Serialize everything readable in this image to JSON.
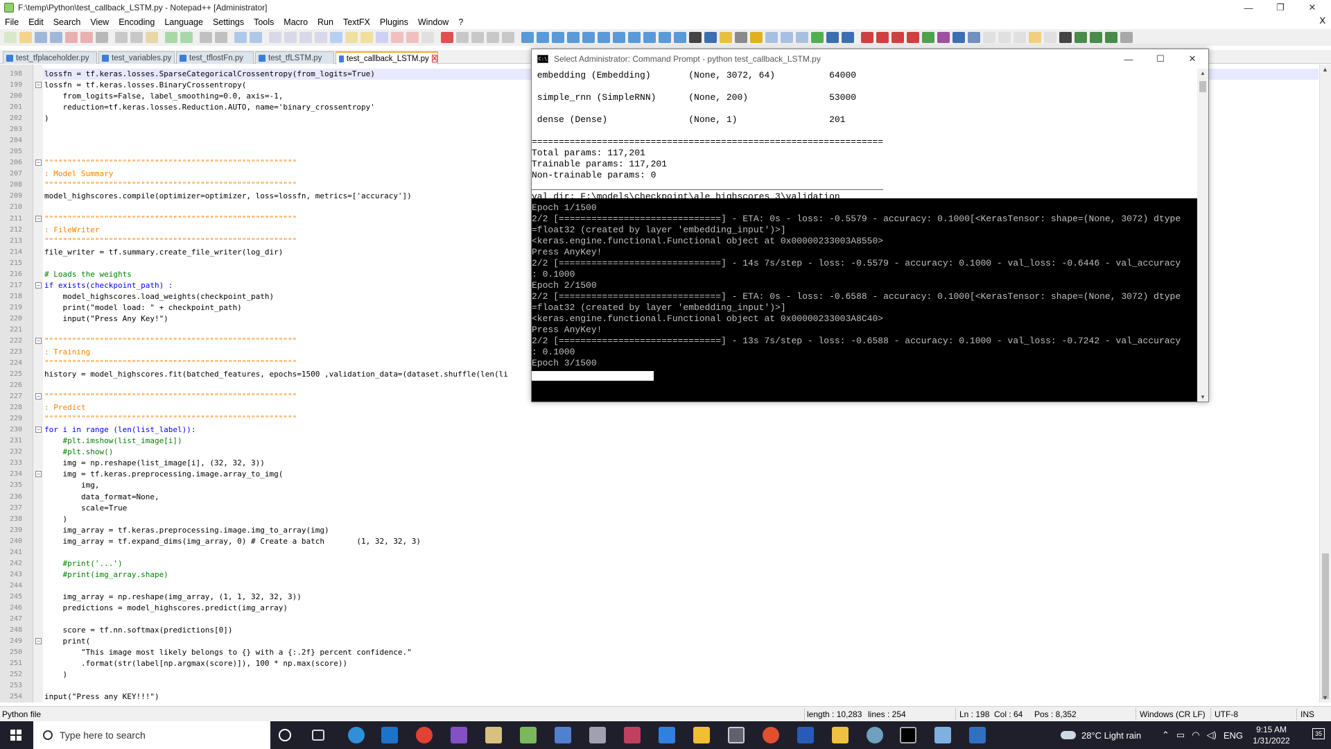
{
  "window": {
    "title": "F:\\temp\\Python\\test_callback_LSTM.py - Notepad++ [Administrator]",
    "minimize": "—",
    "maximize": "❐",
    "close": "✕"
  },
  "menu": {
    "items": [
      "File",
      "Edit",
      "Search",
      "View",
      "Encoding",
      "Language",
      "Settings",
      "Tools",
      "Macro",
      "Run",
      "TextFX",
      "Plugins",
      "Window",
      "?"
    ],
    "close_doc": "X"
  },
  "tabs": [
    {
      "label": "test_tfplaceholder.py"
    },
    {
      "label": "test_variables.py"
    },
    {
      "label": "test_tflostFn.py"
    },
    {
      "label": "test_tfLSTM.py"
    },
    {
      "label": "test_callback_LSTM.py",
      "close": "x"
    }
  ],
  "editor": {
    "lines": [
      {
        "n": "198",
        "t": "lossfn = tf.keras.losses.SparseCategoricalCrossentropy(from_logits=True)"
      },
      {
        "n": "199",
        "t": "lossfn = tf.keras.losses.BinaryCrossentropy("
      },
      {
        "n": "200",
        "t": "    from_logits=False, label_smoothing=0.0, axis=-1,"
      },
      {
        "n": "201",
        "t": "    reduction=tf.keras.losses.Reduction.AUTO, name='binary_crossentropy'"
      },
      {
        "n": "202",
        "t": ")"
      },
      {
        "n": "203",
        "t": ""
      },
      {
        "n": "204",
        "t": ""
      },
      {
        "n": "205",
        "t": ""
      },
      {
        "n": "206",
        "t": "\"\"\"\"\"\"\"\"\"\"\"\"\"\"\"\"\"\"\"\"\"\"\"\"\"\"\"\"\"\"\"\"\"\"\"\"\"\"\"\"\"\"\"\"\"\"\"\"\"\"\"\"\"\"\""
      },
      {
        "n": "207",
        "t": ": Model Summary"
      },
      {
        "n": "208",
        "t": "\"\"\"\"\"\"\"\"\"\"\"\"\"\"\"\"\"\"\"\"\"\"\"\"\"\"\"\"\"\"\"\"\"\"\"\"\"\"\"\"\"\"\"\"\"\"\"\"\"\"\"\"\"\"\""
      },
      {
        "n": "209",
        "t": "model_highscores.compile(optimizer=optimizer, loss=lossfn, metrics=['accuracy'])"
      },
      {
        "n": "210",
        "t": ""
      },
      {
        "n": "211",
        "t": "\"\"\"\"\"\"\"\"\"\"\"\"\"\"\"\"\"\"\"\"\"\"\"\"\"\"\"\"\"\"\"\"\"\"\"\"\"\"\"\"\"\"\"\"\"\"\"\"\"\"\"\"\"\"\""
      },
      {
        "n": "212",
        "t": ": FileWriter"
      },
      {
        "n": "213",
        "t": "\"\"\"\"\"\"\"\"\"\"\"\"\"\"\"\"\"\"\"\"\"\"\"\"\"\"\"\"\"\"\"\"\"\"\"\"\"\"\"\"\"\"\"\"\"\"\"\"\"\"\"\"\"\"\""
      },
      {
        "n": "214",
        "t": "file_writer = tf.summary.create_file_writer(log_dir)"
      },
      {
        "n": "215",
        "t": ""
      },
      {
        "n": "216",
        "t": "# Loads the weights"
      },
      {
        "n": "217",
        "t": "if exists(checkpoint_path) :"
      },
      {
        "n": "218",
        "t": "    model_highscores.load_weights(checkpoint_path)"
      },
      {
        "n": "219",
        "t": "    print(\"model load: \" + checkpoint_path)"
      },
      {
        "n": "220",
        "t": "    input(\"Press Any Key!\")"
      },
      {
        "n": "221",
        "t": ""
      },
      {
        "n": "222",
        "t": "\"\"\"\"\"\"\"\"\"\"\"\"\"\"\"\"\"\"\"\"\"\"\"\"\"\"\"\"\"\"\"\"\"\"\"\"\"\"\"\"\"\"\"\"\"\"\"\"\"\"\"\"\"\"\""
      },
      {
        "n": "223",
        "t": ": Training"
      },
      {
        "n": "224",
        "t": "\"\"\"\"\"\"\"\"\"\"\"\"\"\"\"\"\"\"\"\"\"\"\"\"\"\"\"\"\"\"\"\"\"\"\"\"\"\"\"\"\"\"\"\"\"\"\"\"\"\"\"\"\"\"\""
      },
      {
        "n": "225",
        "t": "history = model_highscores.fit(batched_features, epochs=1500 ,validation_data=(dataset.shuffle(len(li"
      },
      {
        "n": "226",
        "t": ""
      },
      {
        "n": "227",
        "t": "\"\"\"\"\"\"\"\"\"\"\"\"\"\"\"\"\"\"\"\"\"\"\"\"\"\"\"\"\"\"\"\"\"\"\"\"\"\"\"\"\"\"\"\"\"\"\"\"\"\"\"\"\"\"\""
      },
      {
        "n": "228",
        "t": ": Predict"
      },
      {
        "n": "229",
        "t": "\"\"\"\"\"\"\"\"\"\"\"\"\"\"\"\"\"\"\"\"\"\"\"\"\"\"\"\"\"\"\"\"\"\"\"\"\"\"\"\"\"\"\"\"\"\"\"\"\"\"\"\"\"\"\""
      },
      {
        "n": "230",
        "t": "for i in range (len(list_label)):"
      },
      {
        "n": "231",
        "t": "    #plt.imshow(list_image[i])"
      },
      {
        "n": "232",
        "t": "    #plt.show()"
      },
      {
        "n": "233",
        "t": "    img = np.reshape(list_image[i], (32, 32, 3))"
      },
      {
        "n": "234",
        "t": "    img = tf.keras.preprocessing.image.array_to_img("
      },
      {
        "n": "235",
        "t": "        img,"
      },
      {
        "n": "236",
        "t": "        data_format=None,"
      },
      {
        "n": "237",
        "t": "        scale=True"
      },
      {
        "n": "238",
        "t": "    )"
      },
      {
        "n": "239",
        "t": "    img_array = tf.keras.preprocessing.image.img_to_array(img)"
      },
      {
        "n": "240",
        "t": "    img_array = tf.expand_dims(img_array, 0) # Create a batch       (1, 32, 32, 3)"
      },
      {
        "n": "241",
        "t": ""
      },
      {
        "n": "242",
        "t": "    #print('...')"
      },
      {
        "n": "243",
        "t": "    #print(img_array.shape)"
      },
      {
        "n": "244",
        "t": ""
      },
      {
        "n": "245",
        "t": "    img_array = np.reshape(img_array, (1, 1, 32, 32, 3))"
      },
      {
        "n": "246",
        "t": "    predictions = model_highscores.predict(img_array)"
      },
      {
        "n": "247",
        "t": ""
      },
      {
        "n": "248",
        "t": "    score = tf.nn.softmax(predictions[0])"
      },
      {
        "n": "249",
        "t": "    print("
      },
      {
        "n": "250",
        "t": "        \"This image most likely belongs to {} with a {:.2f} percent confidence.\""
      },
      {
        "n": "251",
        "t": "        .format(str(label[np.argmax(score)]), 100 * np.max(score))"
      },
      {
        "n": "252",
        "t": "    )"
      },
      {
        "n": "253",
        "t": ""
      },
      {
        "n": "254",
        "t": "input(\"Press any KEY!!!\")"
      }
    ]
  },
  "console": {
    "title": "Select Administrator: Command Prompt - python  test_callback_LSTM.py",
    "lines": [
      " embedding (Embedding)       (None, 3072, 64)          64000",
      "",
      " simple_rnn (SimpleRNN)      (None, 200)               53000",
      "",
      " dense (Dense)               (None, 1)                 201",
      "",
      "=================================================================",
      "Total params: 117,201",
      "Trainable params: 117,201",
      "Non-trainable params: 0",
      "_________________________________________________________________",
      "val_dir: F:\\models\\checkpoint\\ale_highscores_3\\validation",
      "Epoch 1/1500",
      "2/2 [==============================] - ETA: 0s - loss: -0.5579 - accuracy: 0.1000[<KerasTensor: shape=(None, 3072) dtype",
      "=float32 (created by layer 'embedding_input')>]",
      "<keras.engine.functional.Functional object at 0x00000233003A8550>",
      "Press AnyKey!",
      "2/2 [==============================] - 14s 7s/step - loss: -0.5579 - accuracy: 0.1000 - val_loss: -0.6446 - val_accuracy",
      ": 0.1000",
      "Epoch 2/1500",
      "2/2 [==============================] - ETA: 0s - loss: -0.6588 - accuracy: 0.1000[<KerasTensor: shape=(None, 3072) dtype",
      "=float32 (created by layer 'embedding_input')>]",
      "<keras.engine.functional.Functional object at 0x00000233003A8C40>",
      "Press AnyKey!",
      "2/2 [==============================] - 13s 7s/step - loss: -0.6588 - accuracy: 0.1000 - val_loss: -0.7242 - val_accuracy",
      ": 0.1000",
      "Epoch 3/1500"
    ],
    "minimize": "—",
    "maximize": "☐",
    "close": "✕"
  },
  "status": {
    "file_type": "Python file",
    "length": "length : 10,283",
    "lines": "lines : 254",
    "ln": "Ln : 198",
    "col": "Col : 64",
    "pos": "Pos : 8,352",
    "eol": "Windows (CR LF)",
    "encoding": "UTF-8",
    "mode": "INS"
  },
  "taskbar": {
    "search_placeholder": "Type here to search",
    "weather": "28°C  Light rain",
    "lang": "ENG",
    "time": "9:15 AM",
    "date": "1/31/2022",
    "notif_count": "35"
  },
  "colors": {
    "keyword": "#0000ff",
    "string": "#808080",
    "number": "#ff8000",
    "comment": "#008000",
    "taskbar": "#1f1f2c",
    "active_tab_accent": "#f9a825"
  }
}
